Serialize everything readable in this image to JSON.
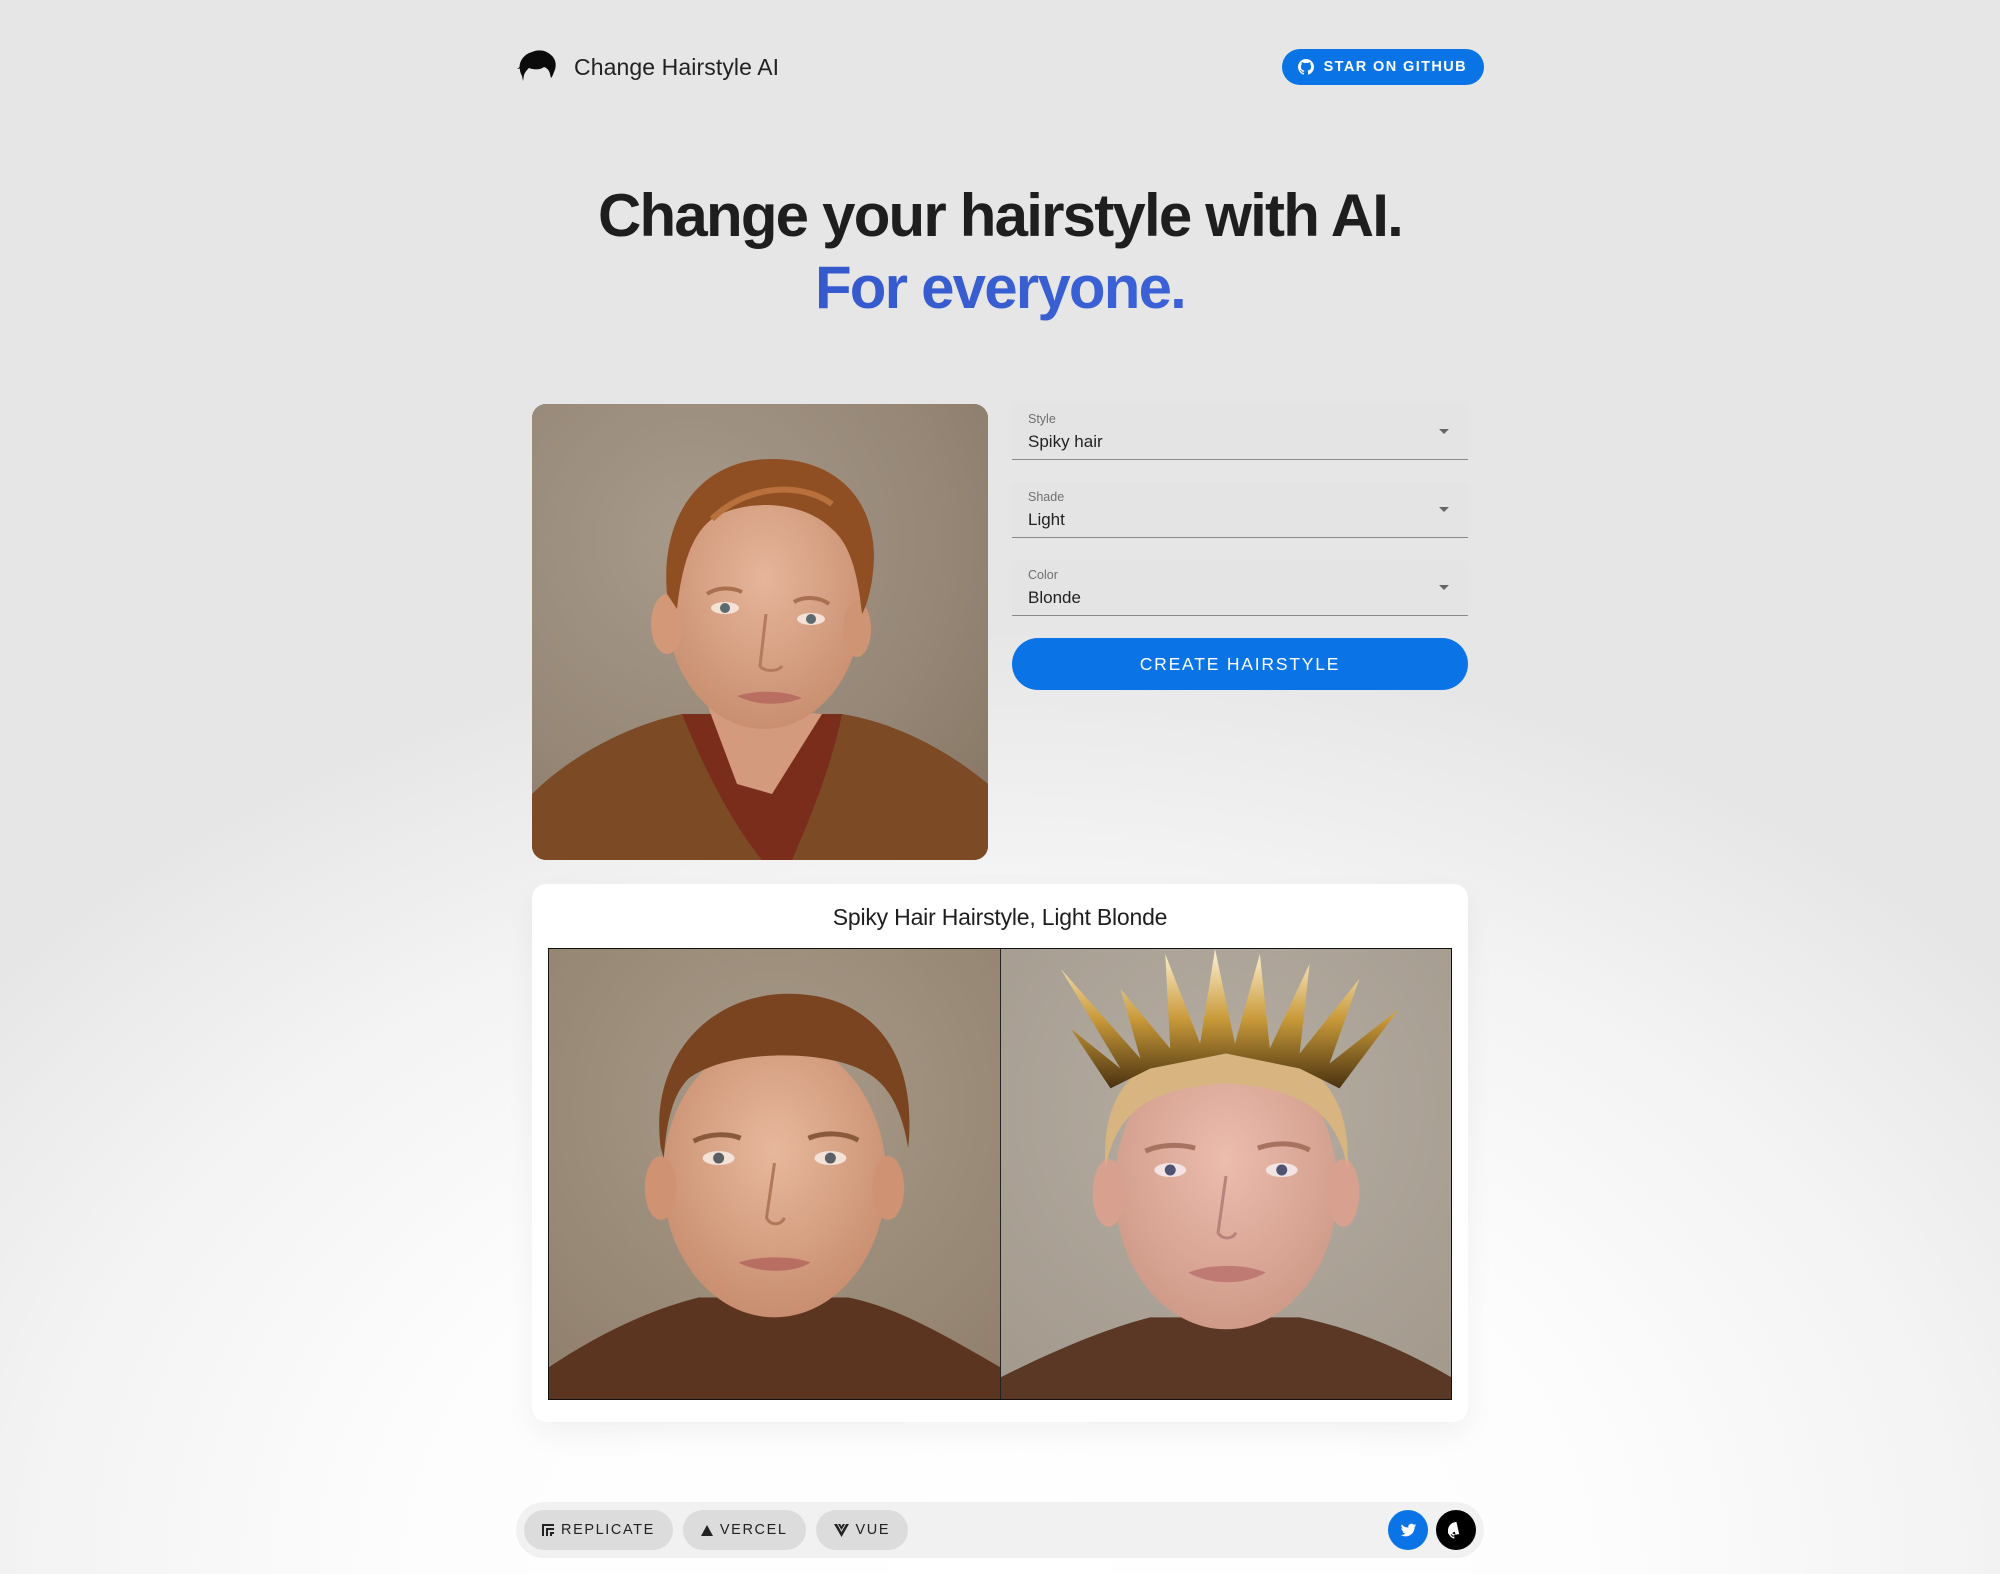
{
  "header": {
    "logo_icon": "hair-icon",
    "title": "Change Hairstyle AI",
    "github_button": {
      "icon": "github-icon",
      "label": "STAR ON GITHUB"
    }
  },
  "hero": {
    "headline": "Change your hairstyle with AI.",
    "subheadline": "For everyone."
  },
  "upload": {
    "photo_alt": "Uploaded portrait photo of a man with reddish-brown hair in a brown knit jacket"
  },
  "form": {
    "fields": [
      {
        "label": "Style",
        "value": "Spiky hair"
      },
      {
        "label": "Shade",
        "value": "Light"
      },
      {
        "label": "Color",
        "value": "Blonde"
      }
    ],
    "submit_label": "CREATE HAIRSTYLE"
  },
  "result": {
    "title": "Spiky Hair Hairstyle, Light Blonde",
    "before_alt": "Original face, brown side-swept hair",
    "after_alt": "Generated face with light blonde spiky hair"
  },
  "footer": {
    "chips": [
      {
        "icon": "replicate-icon",
        "label": "REPLICATE"
      },
      {
        "icon": "vercel-icon",
        "label": "VERCEL"
      },
      {
        "icon": "vue-icon",
        "label": "VUE"
      }
    ],
    "socials": [
      {
        "icon": "twitter-icon",
        "name": "Twitter"
      },
      {
        "icon": "github-icon",
        "name": "GitHub"
      }
    ]
  },
  "colors": {
    "accent": "#0a74e6",
    "headline_blue": "#2a47b8",
    "text": "#1e1e1e"
  }
}
